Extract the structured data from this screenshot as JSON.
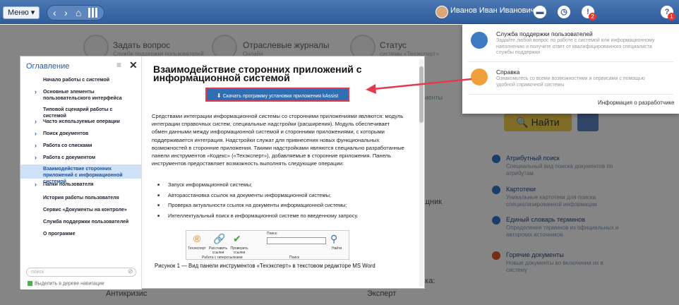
{
  "topbar": {
    "menu_label": "Меню ▾",
    "user_name": "Иванов Иван Иванович",
    "badge_1": "2",
    "badge_2": "1"
  },
  "background": {
    "items": [
      {
        "title": "Задать вопрос",
        "sub": "Службе поддержки пользователей"
      },
      {
        "title": "Отраслевые журналы",
        "sub": "Онлайн"
      },
      {
        "title": "Статус",
        "sub": "системы «Техэксперт»"
      }
    ],
    "tabs_fragment": "алменты",
    "search_button": "🔍 Найти",
    "right_list": [
      {
        "title": "Атрибутный поиск",
        "desc": "Специальный вид поиска документов по атрибутам"
      },
      {
        "title": "Картотеки",
        "desc": "Уникальные картотеки для поиска специализированной информации"
      },
      {
        "title": "Единый словарь терминов",
        "desc": "Определения терминов из официальных и авторских источников"
      },
      {
        "title": "Горячие документы",
        "desc": "Новые документы во включении их в систему"
      }
    ],
    "frag_schnik": "щник",
    "frag_antikrizis": "Антикризис",
    "frag_ekspert": "Эксперт",
    "frag_ika": "ика:"
  },
  "toc": {
    "heading": "Оглавление",
    "items": [
      "Начало работы с системой",
      "Основные элементы пользовательского интерфейса",
      "Типовой сценарий работы с системой",
      "Часто используемые операции",
      "Поиск документов",
      "Работа со списками",
      "Работа с документом",
      "Взаимодействие сторонних приложений с информационной системой",
      "Папки пользователя",
      "История работы пользователя",
      "Сервис «Документы на контроле»",
      "Служба поддержки пользователей",
      "О программе"
    ],
    "search_placeholder": "поиск",
    "checkbox_label": "Выделить в дереве навигации"
  },
  "content": {
    "title": "Взаимодействие сторонних приложений с информационной системой",
    "download_button": "Скачать программу установки приложения kAssist",
    "body": "Средствами интеграции информационной системы со сторонними приложениями являются: модуль интеграции справочных систем, специальные надстройки (расширения). Модуль обеспечивает обмен данными между информационной системой и сторонними приложениями, с которыми поддерживается интеграция. Надстройки служат для привнесения новых функциональных возможностей в сторонние приложения. Такими надстройками являются специально разработанные панели инструментов «Кодекс» («Техэксперт»), добавляемые в сторонние приложения. Панель инструментов предоставляет возможность выполнять следующие операции:",
    "list": [
      "Запуск информационной системы;",
      "Авторасстановка ссылок на документы информационной системы;",
      "Проверка актуальности ссылок на документы информационной системы;",
      "Интеллектуальный поиск в информационной системе по введенному запросу."
    ],
    "figure": {
      "label_1": "Техэксперт",
      "label_2": "Расставить ссылки",
      "label_3": "Проверить ссылки",
      "group_1": "Работа с гиперссылками",
      "search_label": "Поиск:",
      "find": "Найти",
      "group_2": "Поиск"
    },
    "caption": "Рисунок 1 — Вид панели инструментов «Техэксперт» в текстовом редакторе MS Word"
  },
  "popup": {
    "support_title": "Служба поддержки пользователей",
    "support_desc": "Задайте любой вопрос по работе с системой или информационному наполнению и получите ответ от квалифицированного специалиста службы поддержки",
    "help_title": "Справка",
    "help_desc": "Ознакомьтесь со всеми возможностями и сервисами с помощью удобной справочной системы",
    "dev_link": "Информация о разработчике"
  }
}
